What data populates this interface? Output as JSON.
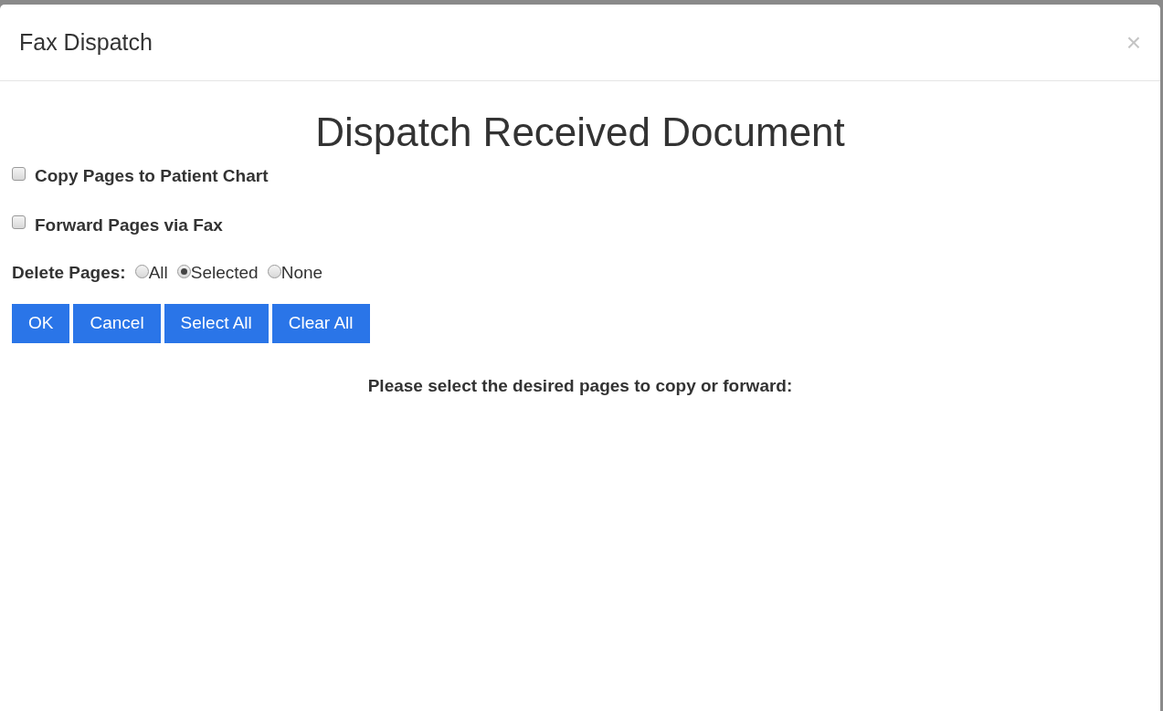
{
  "dialog": {
    "title": "Fax Dispatch",
    "close": "×"
  },
  "heading": "Dispatch Received Document",
  "options": [
    {
      "label": "Copy Pages to Patient Chart",
      "checked": false
    },
    {
      "label": "Forward Pages via Fax",
      "checked": false
    }
  ],
  "delete_pages": {
    "label": "Delete Pages:",
    "choices": [
      {
        "label": "All",
        "selected": false
      },
      {
        "label": "Selected",
        "selected": true
      },
      {
        "label": "None",
        "selected": false
      }
    ]
  },
  "buttons": [
    "OK",
    "Cancel",
    "Select All",
    "Clear All"
  ],
  "instruction": "Please select the desired pages to copy or forward:"
}
